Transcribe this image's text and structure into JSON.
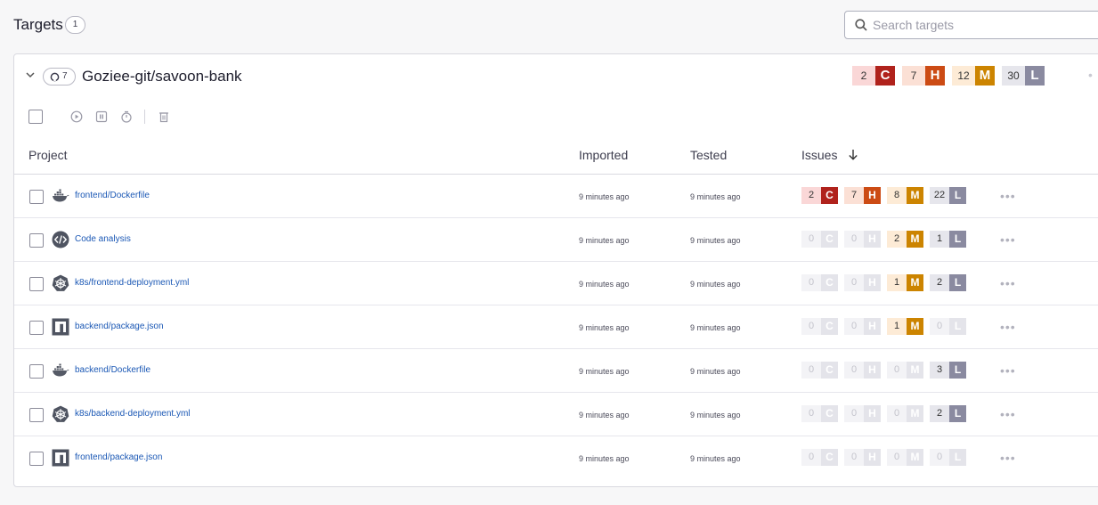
{
  "page": {
    "title": "Targets",
    "count": "1"
  },
  "search": {
    "placeholder": "Search targets"
  },
  "target": {
    "repo_count": "7",
    "name": "Goziee-git/savoon-bank",
    "issues": {
      "critical": "2",
      "high": "7",
      "medium": "12",
      "low": "30"
    }
  },
  "severity_letters": {
    "critical": "C",
    "high": "H",
    "medium": "M",
    "low": "L"
  },
  "columns": {
    "project": "Project",
    "imported": "Imported",
    "tested": "Tested",
    "issues": "Issues"
  },
  "colors": {
    "critical": "#b0221c",
    "high": "#cc4b14",
    "medium": "#cc8400",
    "low": "#8a8aa0",
    "link": "#1b58b5"
  },
  "projects": [
    {
      "icon": "docker-icon",
      "name": "frontend/Dockerfile",
      "imported": "9 minutes ago",
      "tested": "9 minutes ago",
      "c": "2",
      "h": "7",
      "m": "8",
      "l": "22"
    },
    {
      "icon": "code-analysis-icon",
      "name": "Code analysis",
      "imported": "9 minutes ago",
      "tested": "9 minutes ago",
      "c": "0",
      "h": "0",
      "m": "2",
      "l": "1"
    },
    {
      "icon": "kubernetes-icon",
      "name": "k8s/frontend-deployment.yml",
      "imported": "9 minutes ago",
      "tested": "9 minutes ago",
      "c": "0",
      "h": "0",
      "m": "1",
      "l": "2"
    },
    {
      "icon": "npm-icon",
      "name": "backend/package.json",
      "imported": "9 minutes ago",
      "tested": "9 minutes ago",
      "c": "0",
      "h": "0",
      "m": "1",
      "l": "0"
    },
    {
      "icon": "docker-icon",
      "name": "backend/Dockerfile",
      "imported": "9 minutes ago",
      "tested": "9 minutes ago",
      "c": "0",
      "h": "0",
      "m": "0",
      "l": "3"
    },
    {
      "icon": "kubernetes-icon",
      "name": "k8s/backend-deployment.yml",
      "imported": "9 minutes ago",
      "tested": "9 minutes ago",
      "c": "0",
      "h": "0",
      "m": "0",
      "l": "2"
    },
    {
      "icon": "npm-icon",
      "name": "frontend/package.json",
      "imported": "9 minutes ago",
      "tested": "9 minutes ago",
      "c": "0",
      "h": "0",
      "m": "0",
      "l": "0"
    }
  ]
}
